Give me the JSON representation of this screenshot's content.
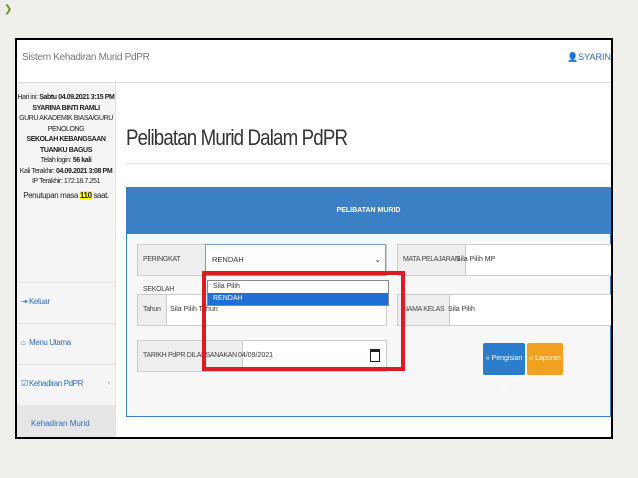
{
  "app": {
    "title": "Sistem Kehadiran Murid PdPR",
    "user": "SYARIN"
  },
  "sidebar": {
    "info": {
      "hari_ini_label": "Hari ini:",
      "hari_ini_value": "Sabtu 04.09.2021 3:15 PM",
      "name": "SYARINA BINTI RAMLI",
      "role": "GURU AKADEMIK BIASA/GURU PENOLONG",
      "school": "SEKOLAH KEBANGSAAN TUANKU BAGUS",
      "login_label": "Telah login:",
      "login_value": "56 kali",
      "last_label": "Kali Terakhir:",
      "last_value": "04.09.2021 3:08 PM",
      "ip": "IP Terakhir: 172.18.7.251",
      "timeout_prefix": "Penutupan masa",
      "timeout_value": "110",
      "timeout_suffix": "saat."
    },
    "items": [
      {
        "label": "Keluar",
        "icon": "logout-icon"
      },
      {
        "label": "Menu Utama",
        "icon": "home-icon"
      },
      {
        "label": "Kehadiran PdPR",
        "icon": "checkbox-icon"
      }
    ],
    "sub_item": "Kehadiran Murid"
  },
  "main": {
    "page_title": "Pelibatan Murid Dalam PdPR",
    "panel_title": "PELIBATAN MURID",
    "form": {
      "peringkat_label": "PERINGKAT SEKOLAH",
      "peringkat_value": "RENDAH",
      "mata_label": "MATA PELAJARAN",
      "mata_value": "Sila Pilih MP",
      "tahun_label": "Tahun",
      "tahun_value": "Sila Pilih Tahun",
      "kelas_label": "NAMA KELAS",
      "kelas_value": "Sila Pilih",
      "tarikh_label": "TARIKH PdPR DILAKSANAKAN",
      "tarikh_value": "04/09/2021"
    },
    "dropdown_options": [
      "Sila Pilih",
      "RENDAH"
    ],
    "buttons": {
      "pengisian": "« Pengisian »",
      "laporan": "« Laporan »"
    }
  },
  "colors": {
    "header_blue": "#3b7fc4",
    "highlight_red": "#e01a23",
    "button_orange": "#f0a11e"
  }
}
